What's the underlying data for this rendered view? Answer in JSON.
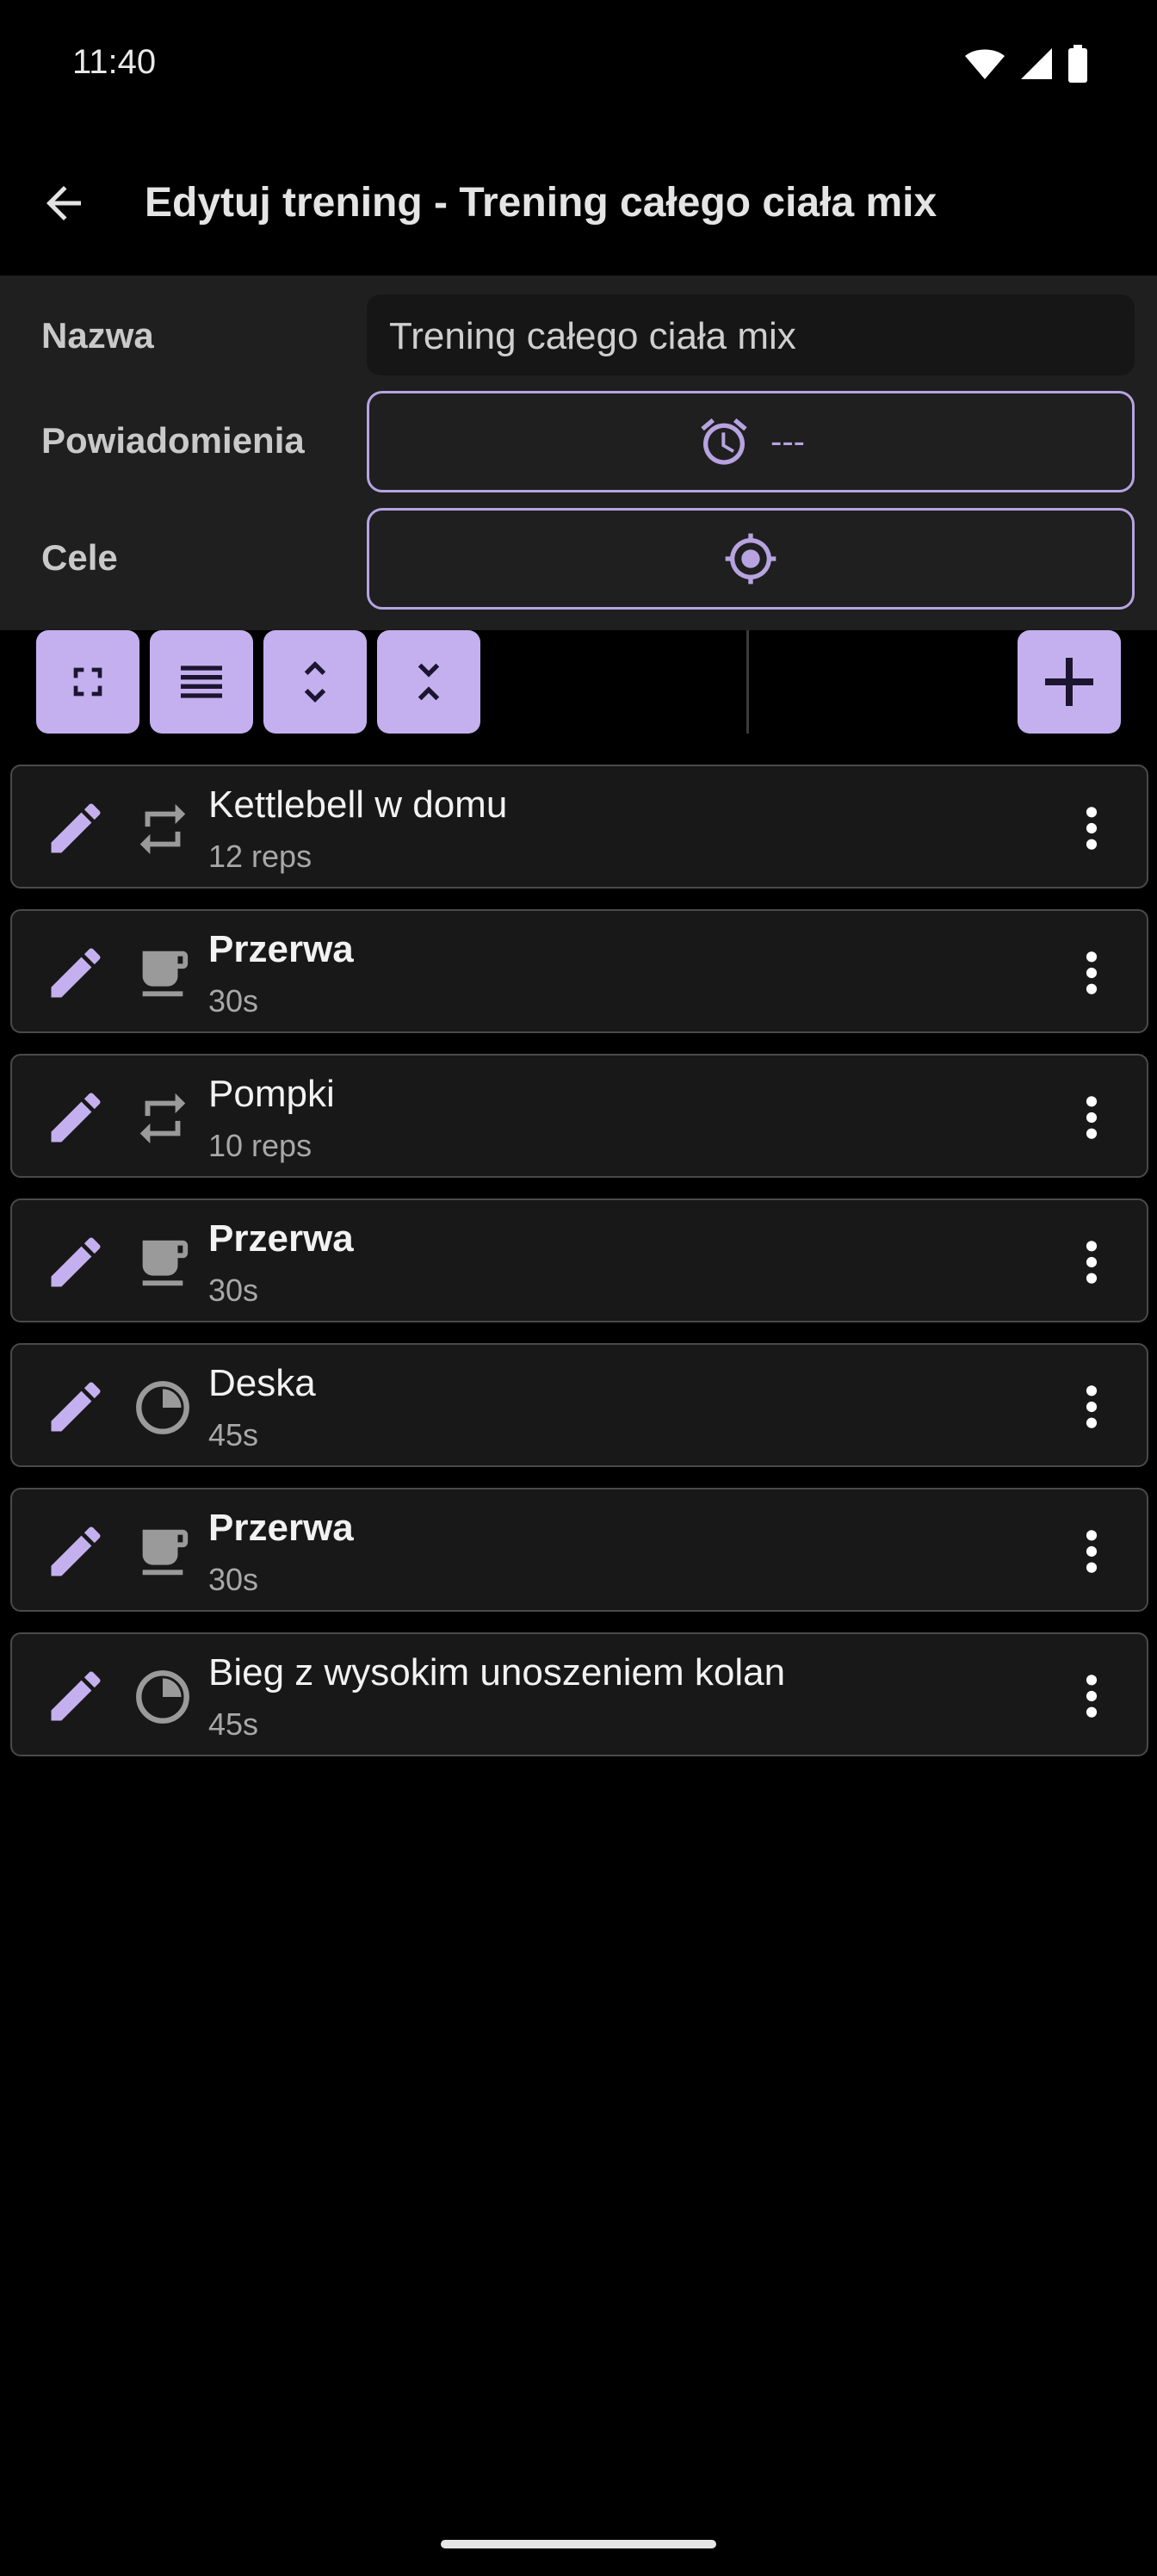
{
  "status_bar": {
    "time": "11:40"
  },
  "app_bar": {
    "title": "Edytuj trening - Trening całego ciała mix"
  },
  "form": {
    "name_label": "Nazwa",
    "name_value": "Trening całego ciała mix",
    "notifications_label": "Powiadomienia",
    "notifications_value": "---",
    "goals_label": "Cele"
  },
  "toolbar": {
    "buttons": [
      "fullscreen-icon",
      "list-icon",
      "expand-icon",
      "collapse-icon"
    ],
    "add": "add-icon"
  },
  "exercises": [
    {
      "name": "Kettlebell w domu",
      "detail": "12 reps",
      "type": "repeat-icon",
      "bold": false
    },
    {
      "name": "Przerwa",
      "detail": "30s",
      "type": "coffee-cup-icon",
      "bold": true
    },
    {
      "name": "Pompki",
      "detail": "10 reps",
      "type": "repeat-icon",
      "bold": false
    },
    {
      "name": "Przerwa",
      "detail": "30s",
      "type": "coffee-cup-icon",
      "bold": true
    },
    {
      "name": "Deska",
      "detail": "45s",
      "type": "timer-icon",
      "bold": false
    },
    {
      "name": "Przerwa",
      "detail": "30s",
      "type": "coffee-cup-icon",
      "bold": true
    },
    {
      "name": "Bieg z wysokim unoszeniem kolan",
      "detail": "45s",
      "type": "timer-icon",
      "bold": false
    }
  ],
  "colors": {
    "accent": "#c4b0ee",
    "accent_outline": "#b7a3e0",
    "panel": "#1f1f1f",
    "card": "#181818",
    "card_border": "#4a4a4a"
  }
}
